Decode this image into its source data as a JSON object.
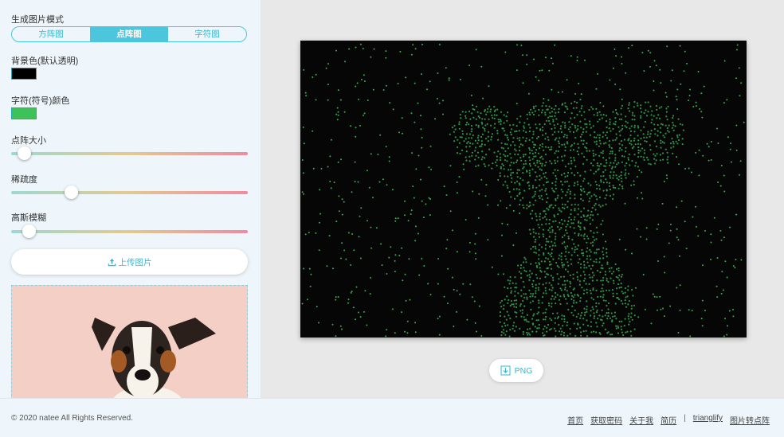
{
  "sidebar": {
    "mode_label": "生成图片模式",
    "modes": [
      {
        "label": "方阵图",
        "active": false
      },
      {
        "label": "点阵图",
        "active": true
      },
      {
        "label": "字符图",
        "active": false
      }
    ],
    "bg_color_label": "背景色(默认透明)",
    "bg_color": "#000000",
    "char_color_label": "字符(符号)颜色",
    "char_color": "#3fc15a",
    "sliders": [
      {
        "label": "点阵大小",
        "value": 0.03
      },
      {
        "label": "稀疏度",
        "value": 0.24
      },
      {
        "label": "高斯模糊",
        "value": 0.05
      }
    ],
    "upload_label": "上传图片",
    "upload_icon": "upload-icon"
  },
  "main": {
    "dot_color": "#3fc15a",
    "canvas_bg": "#050605",
    "download_label": "PNG",
    "download_icon": "download-icon"
  },
  "footer": {
    "copyright": "© 2020 natee All Rights Reserved.",
    "links": [
      "首页",
      "获取密码",
      "关于我",
      "简历"
    ],
    "separator": "|",
    "links2": [
      "trianglify",
      "图片转点阵"
    ]
  }
}
